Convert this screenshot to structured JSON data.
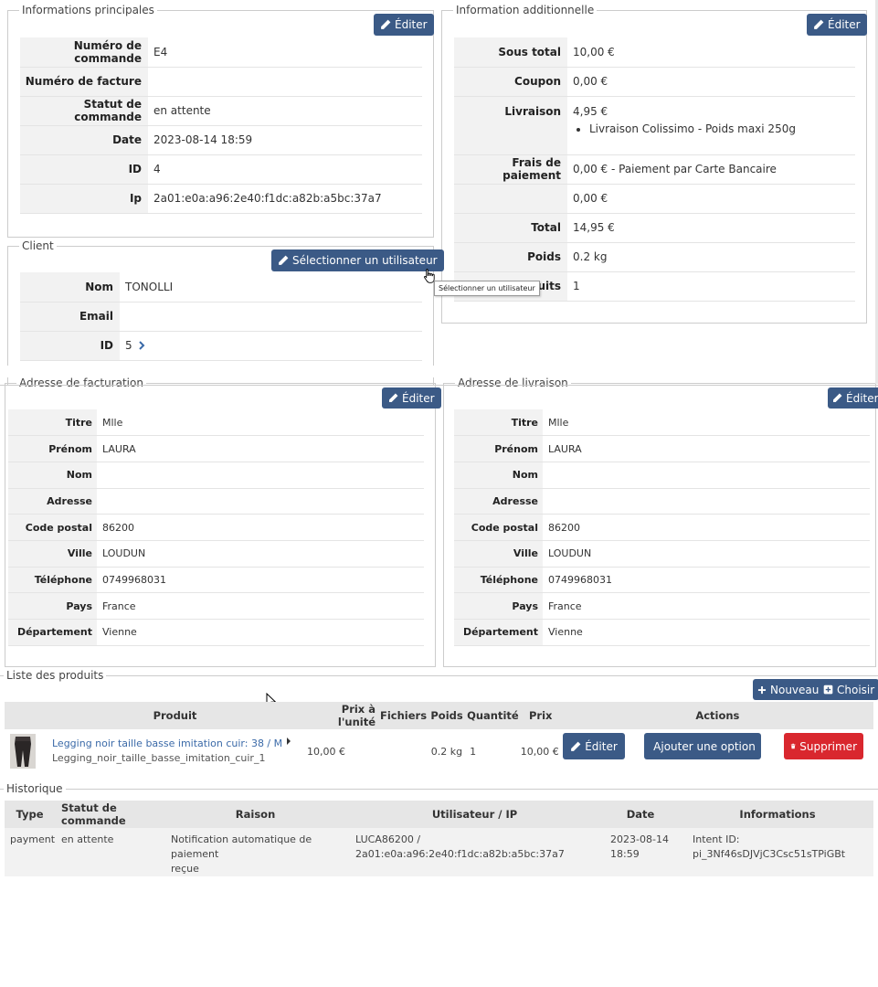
{
  "edit_label": "Éditer",
  "main_info": {
    "legend": "Informations principales",
    "rows": [
      {
        "label": "Numéro de commande",
        "value": "E4"
      },
      {
        "label": "Numéro de facture",
        "value": ""
      },
      {
        "label": "Statut de commande",
        "value": "en attente"
      },
      {
        "label": "Date",
        "value": "2023-08-14 18:59"
      },
      {
        "label": "ID",
        "value": "4"
      },
      {
        "label": "Ip",
        "value": "2a01:e0a:a96:2e40:f1dc:a82b:a5bc:37a7"
      }
    ]
  },
  "additional": {
    "legend": "Information additionnelle",
    "subtotal_label": "Sous total",
    "subtotal": "10,00 €",
    "coupon_label": "Coupon",
    "coupon": "0,00 €",
    "shipping_label": "Livraison",
    "shipping": "4,95 €",
    "shipping_detail": "Livraison Colissimo - Poids maxi 250g",
    "payment_fee_label": "Frais de paiement",
    "payment_fee": "0,00 € - Paiement par Carte Bancaire",
    "extra": "0,00 €",
    "total_label": "Total",
    "total": "14,95 €",
    "weight_label": "Poids",
    "weight": "0.2 kg",
    "products_label": "uits",
    "products": "1"
  },
  "client": {
    "legend": "Client",
    "select_user_label": "Sélectionner un utilisateur",
    "name_label": "Nom",
    "name": "TONOLLI",
    "email_label": "Email",
    "email": "",
    "id_label": "ID",
    "id": "5"
  },
  "tooltip": "Sélectionner un utilisateur",
  "billing": {
    "legend": "Adresse de facturation",
    "rows": [
      {
        "label": "Titre",
        "value": "Mlle"
      },
      {
        "label": "Prénom",
        "value": "LAURA"
      },
      {
        "label": "Nom",
        "value": ""
      },
      {
        "label": "Adresse",
        "value": ""
      },
      {
        "label": "Code postal",
        "value": "86200"
      },
      {
        "label": "Ville",
        "value": "LOUDUN"
      },
      {
        "label": "Téléphone",
        "value": "0749968031"
      },
      {
        "label": "Pays",
        "value": "France"
      },
      {
        "label": "Département",
        "value": "Vienne"
      }
    ]
  },
  "shipping_addr": {
    "legend": "Adresse de livraison",
    "rows": [
      {
        "label": "Titre",
        "value": "Mlle"
      },
      {
        "label": "Prénom",
        "value": "LAURA"
      },
      {
        "label": "Nom",
        "value": ""
      },
      {
        "label": "Adresse",
        "value": ""
      },
      {
        "label": "Code postal",
        "value": "86200"
      },
      {
        "label": "Ville",
        "value": "LOUDUN"
      },
      {
        "label": "Téléphone",
        "value": "0749968031"
      },
      {
        "label": "Pays",
        "value": "France"
      },
      {
        "label": "Département",
        "value": "Vienne"
      }
    ]
  },
  "products": {
    "legend": "Liste des produits",
    "new_label": "Nouveau",
    "choose_label": "Choisir",
    "headers": {
      "product": "Produit",
      "unit_price": "Prix à l'unité",
      "files": "Fichiers",
      "weight": "Poids",
      "quantity": "Quantité",
      "price": "Prix",
      "actions": "Actions"
    },
    "item": {
      "name": "Legging noir taille basse imitation cuir: 38 / M",
      "sku": "Legging_noir_taille_basse_imitation_cuir_1",
      "unit_price": "10,00 €",
      "weight": "0.2 kg",
      "quantity": "1",
      "price": "10,00 €",
      "edit": "Éditer",
      "add_option": "Ajouter une option",
      "delete": "Supprimer"
    }
  },
  "history": {
    "legend": "Historique",
    "headers": {
      "type": "Type",
      "status": "Statut de commande",
      "reason": "Raison",
      "user_ip": "Utilisateur / IP",
      "date": "Date",
      "info": "Informations"
    },
    "row": {
      "type": "payment",
      "status": "en attente",
      "reason_1": "Notification automatique de paiement",
      "reason_2": "reçue",
      "user": "LUCA86200 /",
      "ip": "2a01:e0a:a96:2e40:f1dc:a82b:a5bc:37a7",
      "date_1": "2023-08-14",
      "date_2": "18:59",
      "info_1": "Intent ID:",
      "info_2": "pi_3Nf46sDJVjC3Csc51sTPiGBt"
    }
  },
  "colors": {
    "primary": "#3b5a86",
    "danger": "#d9272e",
    "label_bg": "#f2f2f2",
    "link": "#3b6aa8"
  }
}
